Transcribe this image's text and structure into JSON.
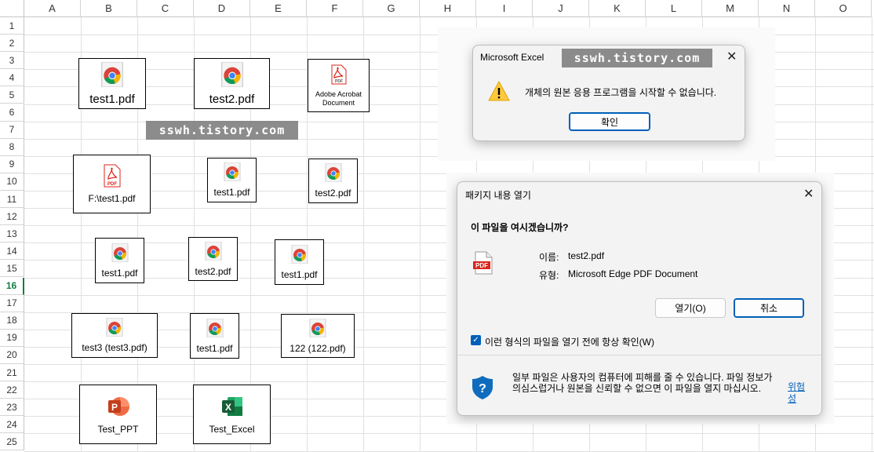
{
  "spreadsheet": {
    "columns": [
      "A",
      "B",
      "C",
      "D",
      "E",
      "F",
      "G",
      "H",
      "I",
      "J",
      "K",
      "L",
      "M",
      "N",
      "O"
    ],
    "rows": [
      "1",
      "2",
      "3",
      "4",
      "5",
      "6",
      "7",
      "8",
      "9",
      "10",
      "11",
      "12",
      "13",
      "14",
      "15",
      "16",
      "17",
      "18",
      "19",
      "20",
      "21",
      "22",
      "23",
      "24",
      "25"
    ],
    "active_row": "16"
  },
  "objects": {
    "o1": "test1.pdf",
    "o2": "test2.pdf",
    "o3": "Adobe Acrobat Document",
    "o4": "F:\\test1.pdf",
    "o5": "test1.pdf",
    "o6": "test2.pdf",
    "o7": "test1.pdf",
    "o8": "test2.pdf",
    "o9": "test1.pdf",
    "o10": "test3 (test3.pdf)",
    "o11": "test1.pdf",
    "o12": "122 (122.pdf)",
    "o13": "Test_PPT",
    "o14": "Test_Excel"
  },
  "watermark_text": "sswh.tistory.com",
  "dialog1": {
    "title": "Microsoft Excel",
    "message": "개체의 원본 응용 프로그램을 시작할 수 없습니다.",
    "ok_label": "확인"
  },
  "dialog2": {
    "title": "패키지 내용 열기",
    "question": "이 파일을 여시겠습니까?",
    "name_label": "이름:",
    "name_value": "test2.pdf",
    "type_label": "유형:",
    "type_value": "Microsoft Edge PDF Document",
    "open_label": "열기(O)",
    "cancel_label": "취소",
    "checkbox_label": "이런 형식의 파일을 열기 전에 항상 확인(W)",
    "checkbox_checked": true,
    "warning_line1": "일부 파일은 사용자의 컴퓨터에 피해를 줄 수 있습니다. 파일 정보가",
    "warning_line2": "의심스럽거나 원본을 신뢰할 수 없으면 이 파일을 열지 마십시오.",
    "help_link": "위험성"
  },
  "colors": {
    "accent": "#005fb8",
    "excel_green": "#107c41",
    "warning": "#ffc83d"
  }
}
